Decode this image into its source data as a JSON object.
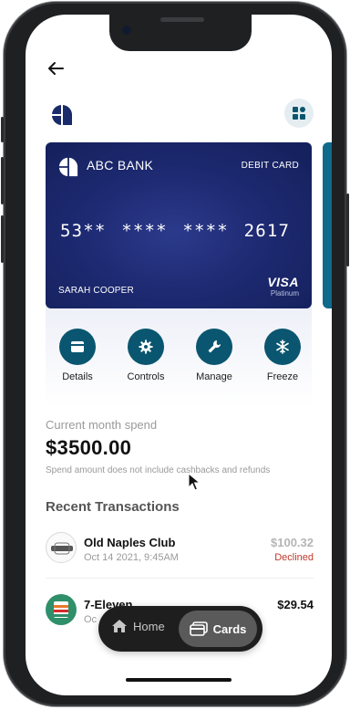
{
  "colors": {
    "accent": "#0a5670",
    "card_background": "#1e2a72",
    "declined": "#c0392b",
    "nav_background": "#1e1e1e"
  },
  "header": {
    "back_icon": "arrow-left-icon",
    "logo_icon": "bank-logo-icon",
    "menu_icon": "grid-icon"
  },
  "card": {
    "bank_name": "ABC BANK",
    "type": "DEBIT CARD",
    "number": "53** **** **** 2617",
    "holder": "SARAH COOPER",
    "network": "VISA",
    "tier": "Platinum"
  },
  "actions": [
    {
      "label": "Details",
      "icon": "card-icon"
    },
    {
      "label": "Controls",
      "icon": "gear-icon"
    },
    {
      "label": "Manage",
      "icon": "wrench-icon"
    },
    {
      "label": "Freeze",
      "icon": "snowflake-icon"
    }
  ],
  "spend": {
    "caption": "Current month spend",
    "amount": "$3500.00",
    "note": "Spend amount does not include cashbacks and refunds"
  },
  "transactions": {
    "title": "Recent Transactions",
    "items": [
      {
        "name": "Old Naples Club",
        "date": "Oct 14 2021, 9:45AM",
        "amount": "$100.32",
        "status": "Declined"
      },
      {
        "name": "7-Eleven",
        "date": "Oc",
        "amount": "$29.54",
        "status": ""
      }
    ]
  },
  "bottom_nav": {
    "items": [
      {
        "label": "Home",
        "icon": "home-icon",
        "active": false
      },
      {
        "label": "Cards",
        "icon": "cards-icon",
        "active": true
      }
    ]
  }
}
